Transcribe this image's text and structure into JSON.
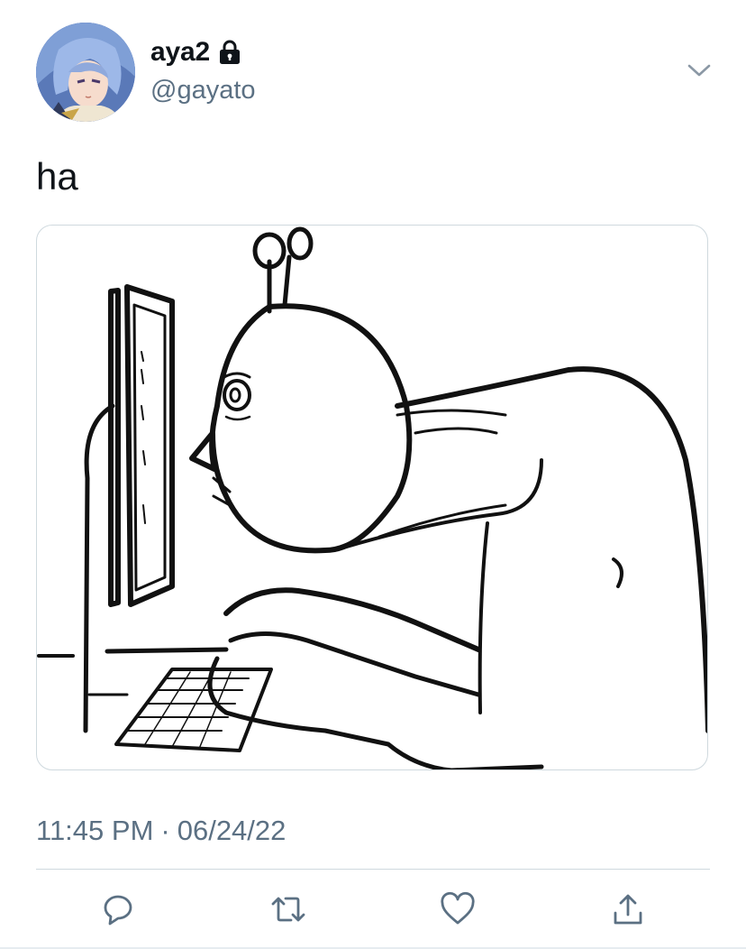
{
  "author": {
    "display_name": "aya2",
    "handle": "@gayato",
    "protected": true,
    "lock_icon": "lock-icon",
    "avatar_icon": "anime-avatar"
  },
  "tweet": {
    "text": "ha",
    "media_description": "sketch-of-creature-at-computer",
    "time": "11:45 PM",
    "separator": "·",
    "date": "06/24/22"
  },
  "actions": {
    "reply_icon": "reply-icon",
    "retweet_icon": "retweet-icon",
    "like_icon": "heart-icon",
    "share_icon": "share-icon",
    "menu_icon": "chevron-down-icon"
  },
  "colors": {
    "text_primary": "#0f1419",
    "text_secondary": "#5b7083",
    "border": "#cfd9de",
    "icon": "#5b7083"
  }
}
